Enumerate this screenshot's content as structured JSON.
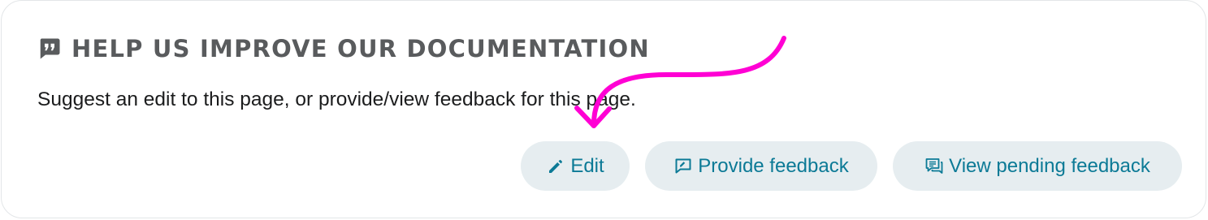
{
  "header": {
    "title": "HELP US IMPROVE OUR DOCUMENTATION",
    "icon": "quote-speech-bubble-icon"
  },
  "description": "Suggest an edit to this page, or provide/view feedback for this page.",
  "actions": {
    "edit": {
      "label": "Edit",
      "icon": "pencil-icon"
    },
    "provide_feedback": {
      "label": "Provide feedback",
      "icon": "feedback-bubble-icon"
    },
    "view_pending": {
      "label": "View pending feedback",
      "icon": "messages-icon"
    }
  },
  "colors": {
    "title_text": "#595b5d",
    "body_text": "#1b1c1d",
    "button_bg": "#e6edf0",
    "button_text": "#0c7a96",
    "annotation_arrow": "#ff00d4",
    "card_border": "#e3e6e8"
  }
}
